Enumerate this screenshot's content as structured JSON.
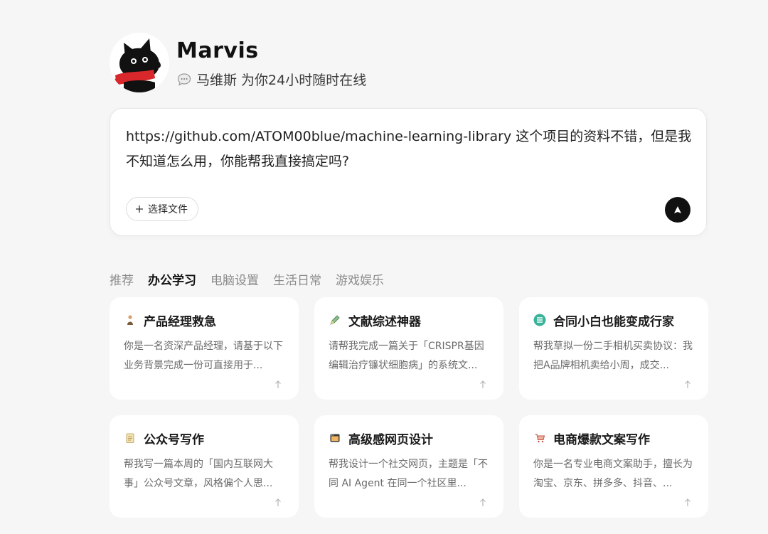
{
  "header": {
    "brand_name": "Marvis",
    "tagline": "马维斯 为你24小时随时在线",
    "avatar_icon": "black-dog-red-scarf-avatar",
    "tagline_icon": "chat-bubble-icon"
  },
  "input": {
    "text": "https://github.com/ATOM00blue/machine-learning-library 这个项目的资料不错，但是我不知道怎么用，你能帮我直接搞定吗?",
    "file_button_label": "选择文件",
    "send_icon": "send-arrow-icon"
  },
  "tabs": [
    {
      "label": "推荐",
      "active": false
    },
    {
      "label": "办公学习",
      "active": true
    },
    {
      "label": "电脑设置",
      "active": false
    },
    {
      "label": "生活日常",
      "active": false
    },
    {
      "label": "游戏娱乐",
      "active": false
    }
  ],
  "cards": [
    {
      "icon": "person-icon",
      "title": "产品经理救急",
      "desc": "你是一名资深产品经理，请基于以下业务背景完成一份可直接用于..."
    },
    {
      "icon": "pen-icon",
      "title": "文献综述神器",
      "desc": "请帮我完成一篇关于「CRISPR基因编辑治疗镰状细胞病」的系统文..."
    },
    {
      "icon": "contract-icon",
      "title": "合同小白也能变成行家",
      "desc": "帮我草拟一份二手相机买卖协议：我把A品牌相机卖给小周，成交..."
    },
    {
      "icon": "notepad-icon",
      "title": "公众号写作",
      "desc": "帮我写一篇本周的「国内互联网大事」公众号文章，风格偏个人思..."
    },
    {
      "icon": "browser-window-icon",
      "title": "高级感网页设计",
      "desc": "帮我设计一个社交网页，主题是「不同 AI Agent 在同一个社区里..."
    },
    {
      "icon": "shopping-cart-icon",
      "title": "电商爆款文案写作",
      "desc": "你是一名专业电商文案助手，擅长为淘宝、京东、拼多多、抖音、..."
    }
  ],
  "colors": {
    "background": "#f6f6f6",
    "card": "#ffffff",
    "send_button": "#111111",
    "scarf_red": "#d8282b",
    "contract_teal": "#3bb39a"
  }
}
